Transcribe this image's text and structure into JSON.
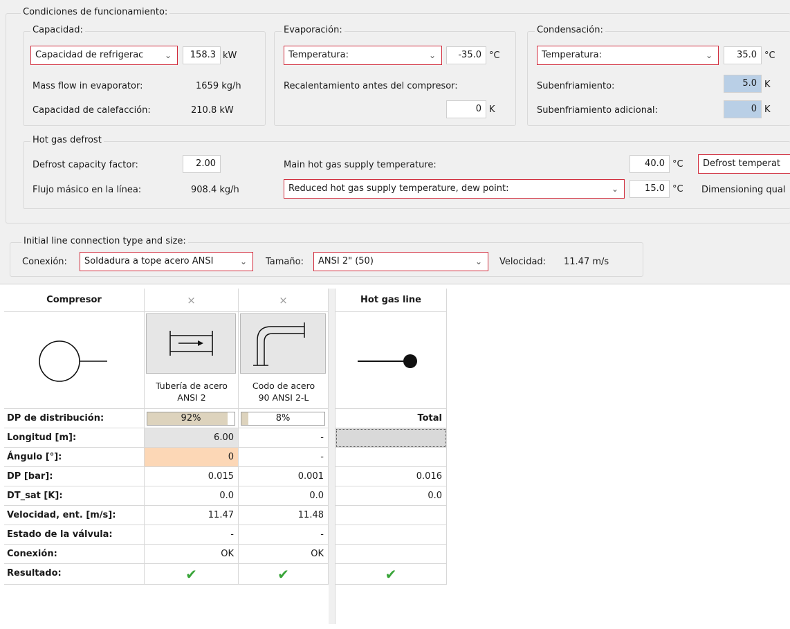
{
  "conditions": {
    "title": "Condiciones de funcionamiento:",
    "capacity": {
      "title": "Capacidad:",
      "type_select": "Capacidad de refrigerac",
      "value": "158.3",
      "unit": "kW",
      "mass_flow_label": "Mass flow in evaporator:",
      "mass_flow_value": "1659 kg/h",
      "heating_label": "Capacidad de calefacción:",
      "heating_value": "210.8 kW"
    },
    "evaporation": {
      "title": "Evaporación:",
      "type_select": "Temperatura:",
      "value": "-35.0",
      "unit": "°C",
      "superheat_label": "Recalentamiento antes del compresor:",
      "superheat_value": "0",
      "superheat_unit": "K"
    },
    "condensation": {
      "title": "Condensación:",
      "type_select": "Temperatura:",
      "value": "35.0",
      "unit": "°C",
      "subcool_label": "Subenfriamiento:",
      "subcool_value": "5.0",
      "subcool_unit": "K",
      "extra_subcool_label": "Subenfriamiento adicional:",
      "extra_subcool_value": "0",
      "extra_subcool_unit": "K"
    },
    "defrost": {
      "title": "Hot gas defrost",
      "factor_label": "Defrost capacity factor:",
      "factor_value": "2.00",
      "flow_label": "Flujo másico en la línea:",
      "flow_value": "908.4 kg/h",
      "main_supply_label": "Main hot gas supply temperature:",
      "main_supply_value": "40.0",
      "main_supply_unit": "°C",
      "defrost_temp_select": "Defrost temperat",
      "reduced_select": "Reduced hot gas supply temperature, dew point:",
      "reduced_value": "15.0",
      "reduced_unit": "°C",
      "dim_quality_label": "Dimensioning qual"
    }
  },
  "initial_line": {
    "title": "Initial line connection type and size:",
    "connection_label": "Conexión:",
    "connection_select": "Soldadura a tope acero ANSI",
    "size_label": "Tamaño:",
    "size_select": "ANSI 2\" (50)",
    "velocity_label": "Velocidad:",
    "velocity_value": "11.47 m/s"
  },
  "table": {
    "header_first": "Compresor",
    "header_last": "Hot gas line",
    "close_glyph": "×",
    "components": [
      {
        "caption_line1": "Tubería de acero",
        "caption_line2": "ANSI 2",
        "distribution": "92%",
        "distribution_fraction": 0.92
      },
      {
        "caption_line1": "Codo de acero",
        "caption_line2": "90 ANSI 2-L",
        "distribution": "8%",
        "distribution_fraction": 0.08
      }
    ],
    "total_label": "Total",
    "rows": [
      {
        "label": "DP de distribución:"
      },
      {
        "label": "Longitud [m]:",
        "c1": "6.00",
        "c2": "-",
        "total": ""
      },
      {
        "label": "Ángulo [°]:",
        "c1": "0",
        "c2": "-",
        "total": ""
      },
      {
        "label": "DP [bar]:",
        "c1": "0.015",
        "c2": "0.001",
        "total": "0.016"
      },
      {
        "label": "DT_sat [K]:",
        "c1": "0.0",
        "c2": "0.0",
        "total": "0.0"
      },
      {
        "label": "Velocidad, ent. [m/s]:",
        "c1": "11.47",
        "c2": "11.48",
        "total": ""
      },
      {
        "label": "Estado de la válvula:",
        "c1": "-",
        "c2": "-",
        "total": ""
      },
      {
        "label": "Conexión:",
        "c1": "OK",
        "c2": "OK",
        "total": ""
      },
      {
        "label": "Resultado:",
        "c1": "✔",
        "c2": "✔",
        "total": "✔"
      }
    ]
  },
  "colors": {
    "accent_red": "#d12c3c",
    "readonly_blue": "#b9cfe6",
    "angle_highlight": "#fcd7b6",
    "check_green": "#3aa53a"
  }
}
